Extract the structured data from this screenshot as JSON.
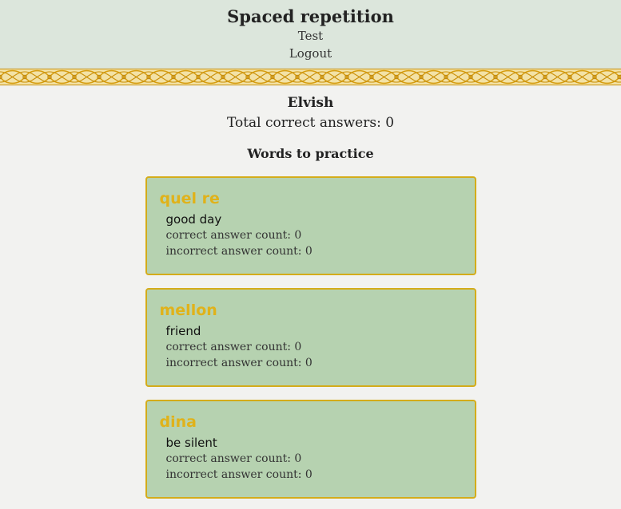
{
  "header": {
    "title": "Spaced repetition",
    "nav": {
      "user_label": "Test",
      "logout_label": "Logout"
    }
  },
  "colors": {
    "header_bg": "#dce6dc",
    "page_bg": "#f2f2f0",
    "card_bg": "#b6d2b0",
    "card_border": "#d4ac1a",
    "accent_gold": "#e0b21a"
  },
  "main": {
    "language": "Elvish",
    "total_correct": "Total correct answers: 0",
    "section_heading": "Words to practice",
    "words": [
      {
        "original": "quel re",
        "translation": "good day",
        "correct": "correct answer count: 0",
        "incorrect": "incorrect answer count: 0"
      },
      {
        "original": "mellon",
        "translation": "friend",
        "correct": "correct answer count: 0",
        "incorrect": "incorrect answer count: 0"
      },
      {
        "original": "dina",
        "translation": "be silent",
        "correct": "correct answer count: 0",
        "incorrect": "incorrect answer count: 0"
      }
    ]
  }
}
